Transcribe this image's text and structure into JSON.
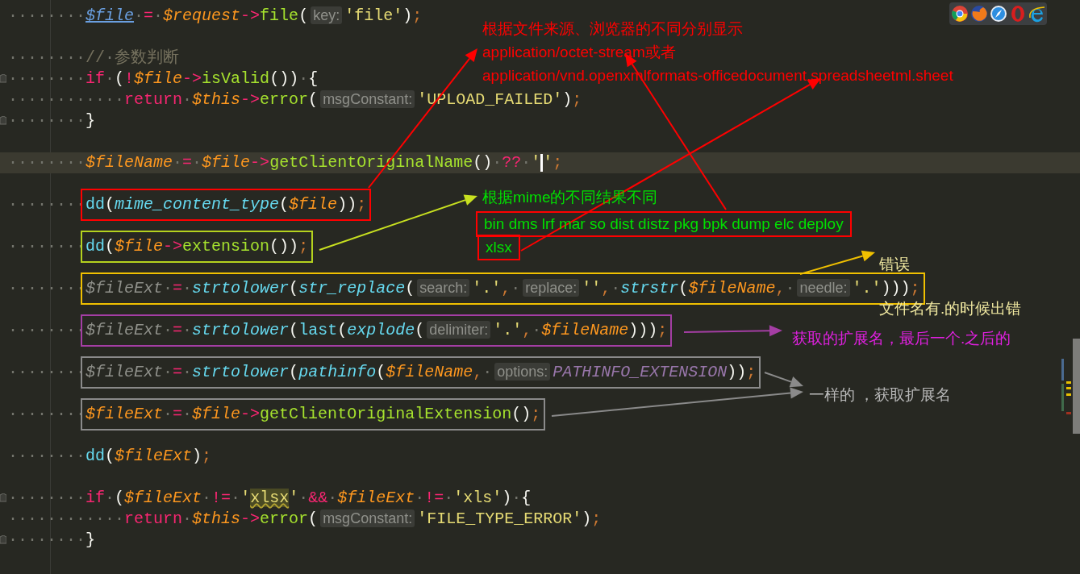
{
  "lines": [
    {
      "kind": "code",
      "indent": "········",
      "fold": false,
      "current": false,
      "segments": [
        {
          "kind": "link",
          "text": "$file"
        },
        {
          "kind": "kw",
          "text": "·=·"
        },
        {
          "kind": "var",
          "text": "$request"
        },
        {
          "kind": "kw",
          "text": "->"
        },
        {
          "kind": "fn",
          "text": "file"
        },
        {
          "kind": "punc",
          "text": "("
        },
        {
          "kind": "hint",
          "text": "key:"
        },
        {
          "kind": "str",
          "text": "'file'"
        },
        {
          "kind": "punc",
          "text": ")"
        },
        {
          "kind": "semi",
          "text": ";"
        }
      ]
    },
    {
      "kind": "blank"
    },
    {
      "kind": "code",
      "indent": "········",
      "fold": false,
      "current": false,
      "segments": [
        {
          "kind": "cmt",
          "text": "//·参数判断"
        }
      ]
    },
    {
      "kind": "code",
      "indent": "········",
      "fold": true,
      "current": false,
      "segments": [
        {
          "kind": "kw",
          "text": "if"
        },
        {
          "kind": "punc",
          "text": "·("
        },
        {
          "kind": "kw",
          "text": "!"
        },
        {
          "kind": "var",
          "text": "$file"
        },
        {
          "kind": "kw",
          "text": "->"
        },
        {
          "kind": "fn",
          "text": "isValid"
        },
        {
          "kind": "punc",
          "text": "())·{"
        }
      ]
    },
    {
      "kind": "code",
      "indent": "············",
      "fold": false,
      "current": false,
      "segments": [
        {
          "kind": "kw",
          "text": "return·"
        },
        {
          "kind": "var",
          "text": "$this"
        },
        {
          "kind": "kw",
          "text": "->"
        },
        {
          "kind": "fn",
          "text": "error"
        },
        {
          "kind": "punc",
          "text": "("
        },
        {
          "kind": "hint",
          "text": "msgConstant:"
        },
        {
          "kind": "str",
          "text": "'UPLOAD_FAILED'"
        },
        {
          "kind": "punc",
          "text": ")"
        },
        {
          "kind": "semi",
          "text": ";"
        }
      ]
    },
    {
      "kind": "code",
      "indent": "········",
      "fold": true,
      "current": false,
      "segments": [
        {
          "kind": "punc",
          "text": "}"
        }
      ]
    },
    {
      "kind": "blank"
    },
    {
      "kind": "code",
      "indent": "········",
      "fold": false,
      "current": true,
      "segments": [
        {
          "kind": "var",
          "text": "$fileName"
        },
        {
          "kind": "kw",
          "text": "·=·"
        },
        {
          "kind": "var",
          "text": "$file"
        },
        {
          "kind": "kw",
          "text": "->"
        },
        {
          "kind": "fn",
          "text": "getClientOriginalName"
        },
        {
          "kind": "punc",
          "text": "()"
        },
        {
          "kind": "kw",
          "text": "·??·"
        },
        {
          "kind": "str_caret",
          "text": "'"
        },
        {
          "kind": "str",
          "text": "'"
        },
        {
          "kind": "semi",
          "text": ";"
        }
      ]
    },
    {
      "kind": "blank"
    },
    {
      "kind": "code",
      "indent": "········",
      "fold": false,
      "current": false,
      "color": "#ff0000",
      "segments": [
        {
          "kind": "plain",
          "text": "dd"
        },
        {
          "kind": "punc",
          "text": "("
        },
        {
          "kind": "call",
          "text": "mime_content_type"
        },
        {
          "kind": "punc",
          "text": "("
        },
        {
          "kind": "var",
          "text": "$file"
        },
        {
          "kind": "punc",
          "text": "))"
        },
        {
          "kind": "semi",
          "text": ";"
        }
      ]
    },
    {
      "kind": "blank"
    },
    {
      "kind": "code",
      "indent": "········",
      "fold": false,
      "current": false,
      "color": "#b4d21e",
      "segments": [
        {
          "kind": "plain",
          "text": "dd"
        },
        {
          "kind": "punc",
          "text": "("
        },
        {
          "kind": "var",
          "text": "$file"
        },
        {
          "kind": "kw",
          "text": "->"
        },
        {
          "kind": "fn",
          "text": "extension"
        },
        {
          "kind": "punc",
          "text": "())"
        },
        {
          "kind": "semi",
          "text": ";"
        }
      ]
    },
    {
      "kind": "blank"
    },
    {
      "kind": "code",
      "indent": "········",
      "fold": false,
      "current": false,
      "color": "#f0c000",
      "segments": [
        {
          "kind": "dim",
          "text": "$fileExt"
        },
        {
          "kind": "kw",
          "text": "·=·"
        },
        {
          "kind": "call",
          "text": "strtolower"
        },
        {
          "kind": "punc",
          "text": "("
        },
        {
          "kind": "call",
          "text": "str_replace"
        },
        {
          "kind": "punc",
          "text": "("
        },
        {
          "kind": "hint",
          "text": "search:"
        },
        {
          "kind": "str",
          "text": "'.'"
        },
        {
          "kind": "semi",
          "text": ",·"
        },
        {
          "kind": "hint",
          "text": "replace:"
        },
        {
          "kind": "str",
          "text": "''"
        },
        {
          "kind": "semi",
          "text": ",·"
        },
        {
          "kind": "call",
          "text": "strstr"
        },
        {
          "kind": "punc",
          "text": "("
        },
        {
          "kind": "var",
          "text": "$fileName"
        },
        {
          "kind": "semi",
          "text": ",·"
        },
        {
          "kind": "hint",
          "text": "needle:"
        },
        {
          "kind": "str",
          "text": "'.'"
        },
        {
          "kind": "punc",
          "text": ")))"
        },
        {
          "kind": "semi",
          "text": ";"
        }
      ]
    },
    {
      "kind": "blank"
    },
    {
      "kind": "code",
      "indent": "········",
      "fold": false,
      "current": false,
      "color": "#a43ea4",
      "segments": [
        {
          "kind": "dim",
          "text": "$fileExt"
        },
        {
          "kind": "kw",
          "text": "·=·"
        },
        {
          "kind": "call",
          "text": "strtolower"
        },
        {
          "kind": "punc",
          "text": "("
        },
        {
          "kind": "plain",
          "text": "last"
        },
        {
          "kind": "punc",
          "text": "("
        },
        {
          "kind": "call",
          "text": "explode"
        },
        {
          "kind": "punc",
          "text": "("
        },
        {
          "kind": "hint",
          "text": "delimiter:"
        },
        {
          "kind": "str",
          "text": "'.'"
        },
        {
          "kind": "semi",
          "text": ",·"
        },
        {
          "kind": "var",
          "text": "$fileName"
        },
        {
          "kind": "punc",
          "text": ")))"
        },
        {
          "kind": "semi",
          "text": ";"
        }
      ]
    },
    {
      "kind": "blank"
    },
    {
      "kind": "code",
      "indent": "········",
      "fold": false,
      "current": false,
      "color": "#8a8a8a",
      "segments": [
        {
          "kind": "dim",
          "text": "$fileExt"
        },
        {
          "kind": "kw",
          "text": "·=·"
        },
        {
          "kind": "call",
          "text": "strtolower"
        },
        {
          "kind": "punc",
          "text": "("
        },
        {
          "kind": "call",
          "text": "pathinfo"
        },
        {
          "kind": "punc",
          "text": "("
        },
        {
          "kind": "var",
          "text": "$fileName"
        },
        {
          "kind": "semi",
          "text": ",·"
        },
        {
          "kind": "hint",
          "text": "options:"
        },
        {
          "kind": "const",
          "text": "PATHINFO_EXTENSION"
        },
        {
          "kind": "punc",
          "text": "))"
        },
        {
          "kind": "semi",
          "text": ";"
        }
      ]
    },
    {
      "kind": "blank"
    },
    {
      "kind": "code",
      "indent": "········",
      "fold": false,
      "current": false,
      "color": "#8a8a8a",
      "segments": [
        {
          "kind": "var",
          "text": "$fileExt"
        },
        {
          "kind": "kw",
          "text": "·=·"
        },
        {
          "kind": "var",
          "text": "$file"
        },
        {
          "kind": "kw",
          "text": "->"
        },
        {
          "kind": "fn",
          "text": "getClientOriginalExtension"
        },
        {
          "kind": "punc",
          "text": "()"
        },
        {
          "kind": "semi",
          "text": ";"
        }
      ]
    },
    {
      "kind": "blank"
    },
    {
      "kind": "code",
      "indent": "········",
      "fold": false,
      "current": false,
      "segments": [
        {
          "kind": "plain",
          "text": "dd"
        },
        {
          "kind": "punc",
          "text": "("
        },
        {
          "kind": "var",
          "text": "$fileExt"
        },
        {
          "kind": "punc",
          "text": ")"
        },
        {
          "kind": "semi",
          "text": ";"
        }
      ]
    },
    {
      "kind": "blank"
    },
    {
      "kind": "code",
      "indent": "········",
      "fold": true,
      "current": false,
      "segments": [
        {
          "kind": "kw",
          "text": "if"
        },
        {
          "kind": "punc",
          "text": "·("
        },
        {
          "kind": "var",
          "text": "$fileExt"
        },
        {
          "kind": "kw",
          "text": "·!=·"
        },
        {
          "kind": "str",
          "text": "'"
        },
        {
          "kind": "match",
          "text": "xlsx"
        },
        {
          "kind": "str",
          "text": "'"
        },
        {
          "kind": "kw",
          "text": "·&&·"
        },
        {
          "kind": "var",
          "text": "$fileExt"
        },
        {
          "kind": "kw",
          "text": "·!=·"
        },
        {
          "kind": "str",
          "text": "'xls'"
        },
        {
          "kind": "punc",
          "text": ")·{"
        }
      ]
    },
    {
      "kind": "code",
      "indent": "············",
      "fold": false,
      "current": false,
      "segments": [
        {
          "kind": "kw",
          "text": "return·"
        },
        {
          "kind": "var",
          "text": "$this"
        },
        {
          "kind": "kw",
          "text": "->"
        },
        {
          "kind": "fn",
          "text": "error"
        },
        {
          "kind": "punc",
          "text": "("
        },
        {
          "kind": "hint",
          "text": "msgConstant:"
        },
        {
          "kind": "str",
          "text": "'FILE_TYPE_ERROR'"
        },
        {
          "kind": "punc",
          "text": ")"
        },
        {
          "kind": "semi",
          "text": ";"
        }
      ]
    },
    {
      "kind": "code",
      "indent": "········",
      "fold": true,
      "current": false,
      "segments": [
        {
          "kind": "punc",
          "text": "}"
        }
      ]
    }
  ],
  "annotations": [
    {
      "text": "根据文件来源、浏览器的不同分别显示",
      "color": "#ff0000",
      "framed": false
    },
    {
      "text": "application/octet-stream或者",
      "color": "#ff0000",
      "framed": false
    },
    {
      "text": "application/vnd.openxmlformats-officedocument.spreadsheetml.sheet",
      "color": "#ff0000",
      "framed": false
    },
    {
      "text": "根据mime的不同结果不同",
      "color": "#00e000",
      "framed": false
    },
    {
      "text": "bin dms lrf mar so dist distz pkg bpk dump elc deploy",
      "color": "#00e000",
      "framed": true
    },
    {
      "text": "xlsx",
      "color": "#00e000",
      "framed": true
    },
    {
      "text": "错误",
      "color": "#f0e8a0",
      "framed": false
    },
    {
      "text": "文件名有.的时候出错",
      "color": "#f0e8a0",
      "framed": false
    },
    {
      "text": "获取的扩展名，最后一个.之后的",
      "color": "#e020e0",
      "framed": false
    },
    {
      "text": "一样的 ，获取扩展名",
      "color": "#b8b8b8",
      "framed": false
    }
  ]
}
